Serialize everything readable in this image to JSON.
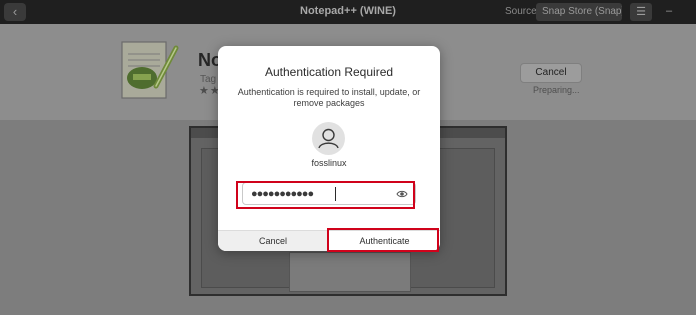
{
  "window": {
    "title": "Notepad++ (WINE)",
    "source_label": "Source",
    "source_value": "Snap Store (Snap)"
  },
  "app": {
    "name_partial": "No",
    "tag_partial": "Tag",
    "stars": "★★",
    "cancel_label": "Cancel",
    "status": "Preparing..."
  },
  "dialog": {
    "title": "Authentication Required",
    "message": "Authentication is required to install, update, or remove packages",
    "username": "fosslinux",
    "password_masked": "●●●●●●●●●●●",
    "cancel_label": "Cancel",
    "authenticate_label": "Authenticate"
  },
  "annotations": {
    "highlight_color": "#d0021b"
  }
}
